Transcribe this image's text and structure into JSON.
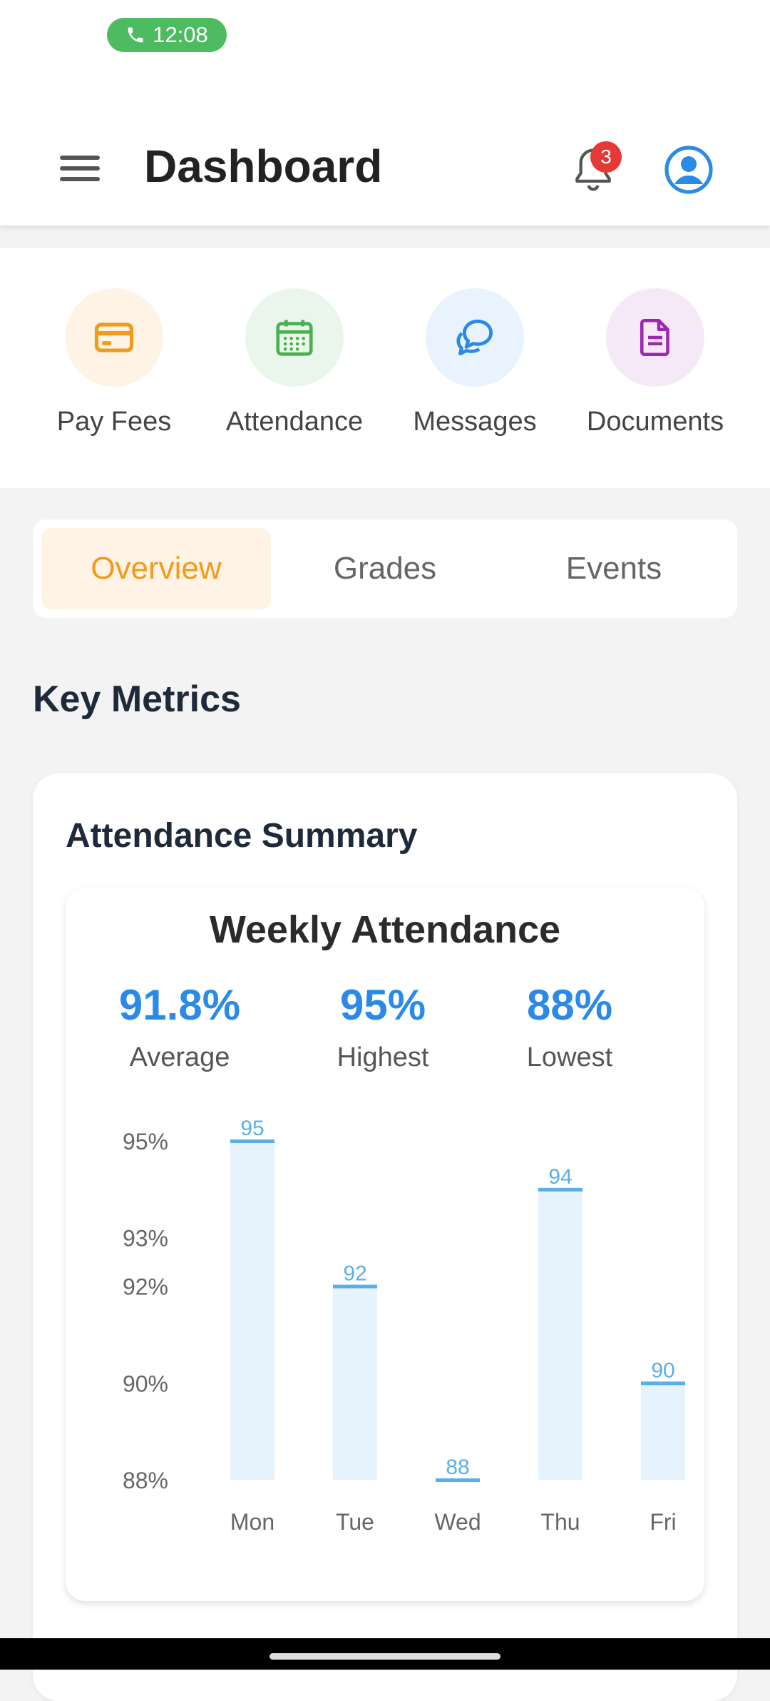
{
  "status": {
    "call_time": "12:08"
  },
  "header": {
    "title": "Dashboard",
    "notification_count": "3"
  },
  "quick_actions": [
    {
      "label": "Pay Fees",
      "icon": "credit-card-icon",
      "bg": "#fff3e6",
      "color": "#f29a1a"
    },
    {
      "label": "Attendance",
      "icon": "calendar-icon",
      "bg": "#eaf6ec",
      "color": "#4caf50"
    },
    {
      "label": "Messages",
      "icon": "chat-icon",
      "bg": "#e8f3fd",
      "color": "#2b8ae6"
    },
    {
      "label": "Documents",
      "icon": "document-icon",
      "bg": "#f6e9f7",
      "color": "#9c27b0"
    }
  ],
  "tabs": [
    {
      "label": "Overview",
      "active": true
    },
    {
      "label": "Grades",
      "active": false
    },
    {
      "label": "Events",
      "active": false
    }
  ],
  "section_title": "Key Metrics",
  "card": {
    "title": "Attendance Summary",
    "chart_title": "Weekly Attendance",
    "stats": [
      {
        "value": "91.8%",
        "label": "Average"
      },
      {
        "value": "95%",
        "label": "Highest"
      },
      {
        "value": "88%",
        "label": "Lowest"
      }
    ]
  },
  "colors": {
    "accent": "#2b8ae6",
    "bar_fill": "#e6f2fc",
    "bar_top": "#5aaee9",
    "active_tab": "#f29a1a"
  },
  "chart_data": {
    "type": "bar",
    "title": "Weekly Attendance",
    "categories": [
      "Mon",
      "Tue",
      "Wed",
      "Thu",
      "Fri"
    ],
    "values": [
      95,
      92,
      88,
      94,
      90
    ],
    "data_labels": [
      "95",
      "92",
      "88",
      "94",
      "90"
    ],
    "y_ticks": [
      95,
      93,
      92,
      90,
      88
    ],
    "y_tick_labels": [
      "95%",
      "93%",
      "92%",
      "90%",
      "88%"
    ],
    "ylim": [
      88,
      95
    ],
    "grid": false,
    "xlabel": "",
    "ylabel": ""
  }
}
